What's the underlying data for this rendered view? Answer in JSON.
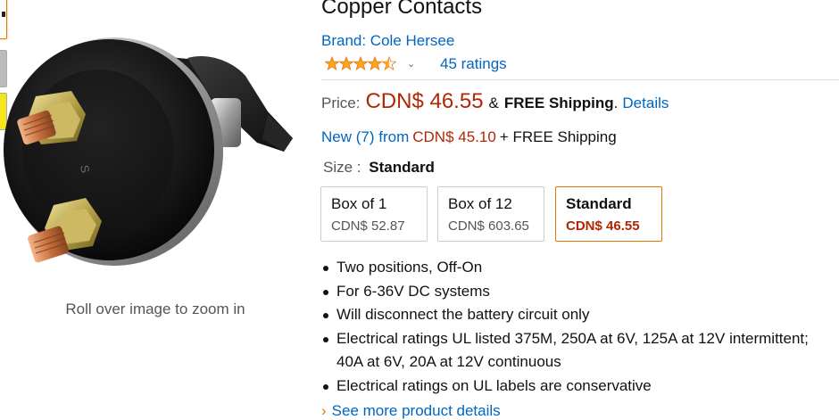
{
  "product": {
    "title": "Copper Contacts",
    "brand": "Brand: Cole Hersee",
    "rating_stars": 4.5,
    "ratings_link": "45 ratings"
  },
  "price": {
    "label": "Price:",
    "value": "CDN$ 46.55",
    "amp": "&",
    "shipping": "FREE Shipping",
    "dot": ".",
    "details_link": "Details"
  },
  "offers": {
    "link": "New (7) from",
    "price": "CDN$ 45.10",
    "shipping": "+ FREE Shipping"
  },
  "size": {
    "label": "Size :",
    "selected": "Standard",
    "options": [
      {
        "name": "Box of 1",
        "price": "CDN$ 52.87"
      },
      {
        "name": "Box of 12",
        "price": "CDN$ 603.65"
      },
      {
        "name": "Standard",
        "price": "CDN$ 46.55"
      }
    ]
  },
  "bullets": [
    "Two positions, Off-On",
    "For 6-36V DC systems",
    "Will disconnect the battery circuit only",
    "Electrical ratings UL listed 375M, 250A at 6V, 125A at 12V intermittent; 40A at 6V, 20A at 12V continuous",
    "Electrical ratings on UL labels are conservative"
  ],
  "see_more": "See more product details",
  "image": {
    "zoom_hint": "Roll over image to zoom in"
  },
  "colors": {
    "link": "#0066c0",
    "price": "#b12704",
    "selected_border": "#e77600",
    "star": "#ffa41c"
  },
  "icons": {
    "star": "star-icon",
    "caret": "chevron-down-icon",
    "see_more": "chevron-right-icon"
  }
}
